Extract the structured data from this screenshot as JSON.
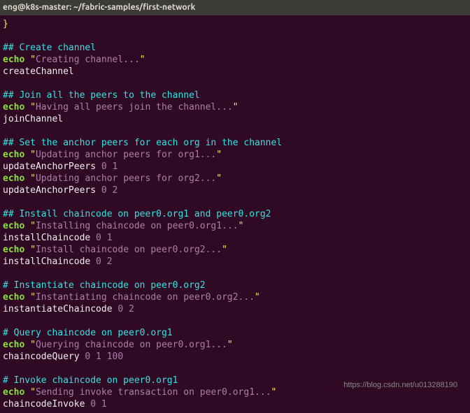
{
  "titlebar": "eng@k8s-master: ~/fabric-samples/first-network",
  "code": {
    "brace": "}",
    "sec1_c": "## Create channel",
    "sec1_echo": "echo",
    "sec1_q1": " \"",
    "sec1_str": "Creating channel...",
    "sec1_q2": "\"",
    "sec1_cmd": "createChannel",
    "sec2_c": "## Join all the peers to the channel",
    "sec2_echo": "echo",
    "sec2_q1": " \"",
    "sec2_str": "Having all peers join the channel...",
    "sec2_q2": "\"",
    "sec2_cmd": "joinChannel",
    "sec3_c": "## Set the anchor peers for each org in the channel",
    "sec3_echo1": "echo",
    "sec3_q1a": " \"",
    "sec3_str1": "Updating anchor peers for org1...",
    "sec3_q1b": "\"",
    "sec3_cmd1": "updateAnchorPeers",
    "sec3_arg1": " 0 1",
    "sec3_echo2": "echo",
    "sec3_q2a": " \"",
    "sec3_str2": "Updating anchor peers for org2...",
    "sec3_q2b": "\"",
    "sec3_cmd2": "updateAnchorPeers",
    "sec3_arg2": " 0 2",
    "sec4_c": "## Install chaincode on peer0.org1 and peer0.org2",
    "sec4_echo1": "echo",
    "sec4_q1a": " \"",
    "sec4_str1": "Installing chaincode on peer0.org1...",
    "sec4_q1b": "\"",
    "sec4_cmd1": "installChaincode",
    "sec4_arg1": " 0 1",
    "sec4_echo2": "echo",
    "sec4_q2a": " \"",
    "sec4_str2": "Install chaincode on peer0.org2...",
    "sec4_q2b": "\"",
    "sec4_cmd2": "installChaincode",
    "sec4_arg2": " 0 2",
    "sec5_c": "# Instantiate chaincode on peer0.org2",
    "sec5_echo": "echo",
    "sec5_q1": " \"",
    "sec5_str": "Instantiating chaincode on peer0.org2...",
    "sec5_q2": "\"",
    "sec5_cmd": "instantiateChaincode",
    "sec5_arg": " 0 2",
    "sec6_c": "# Query chaincode on peer0.org1",
    "sec6_echo": "echo",
    "sec6_q1": " \"",
    "sec6_str": "Querying chaincode on peer0.org1...",
    "sec6_q2": "\"",
    "sec6_cmd": "chaincodeQuery",
    "sec6_arg": " 0 1 100",
    "sec7_c": "# Invoke chaincode on peer0.org1",
    "sec7_echo": "echo",
    "sec7_q1": " \"",
    "sec7_str": "Sending invoke transaction on peer0.org1...",
    "sec7_q2": "\"",
    "sec7_cmd": "chaincodeInvoke",
    "sec7_arg": " 0 1"
  },
  "watermark": "https://blog.csdn.net/u013288190"
}
